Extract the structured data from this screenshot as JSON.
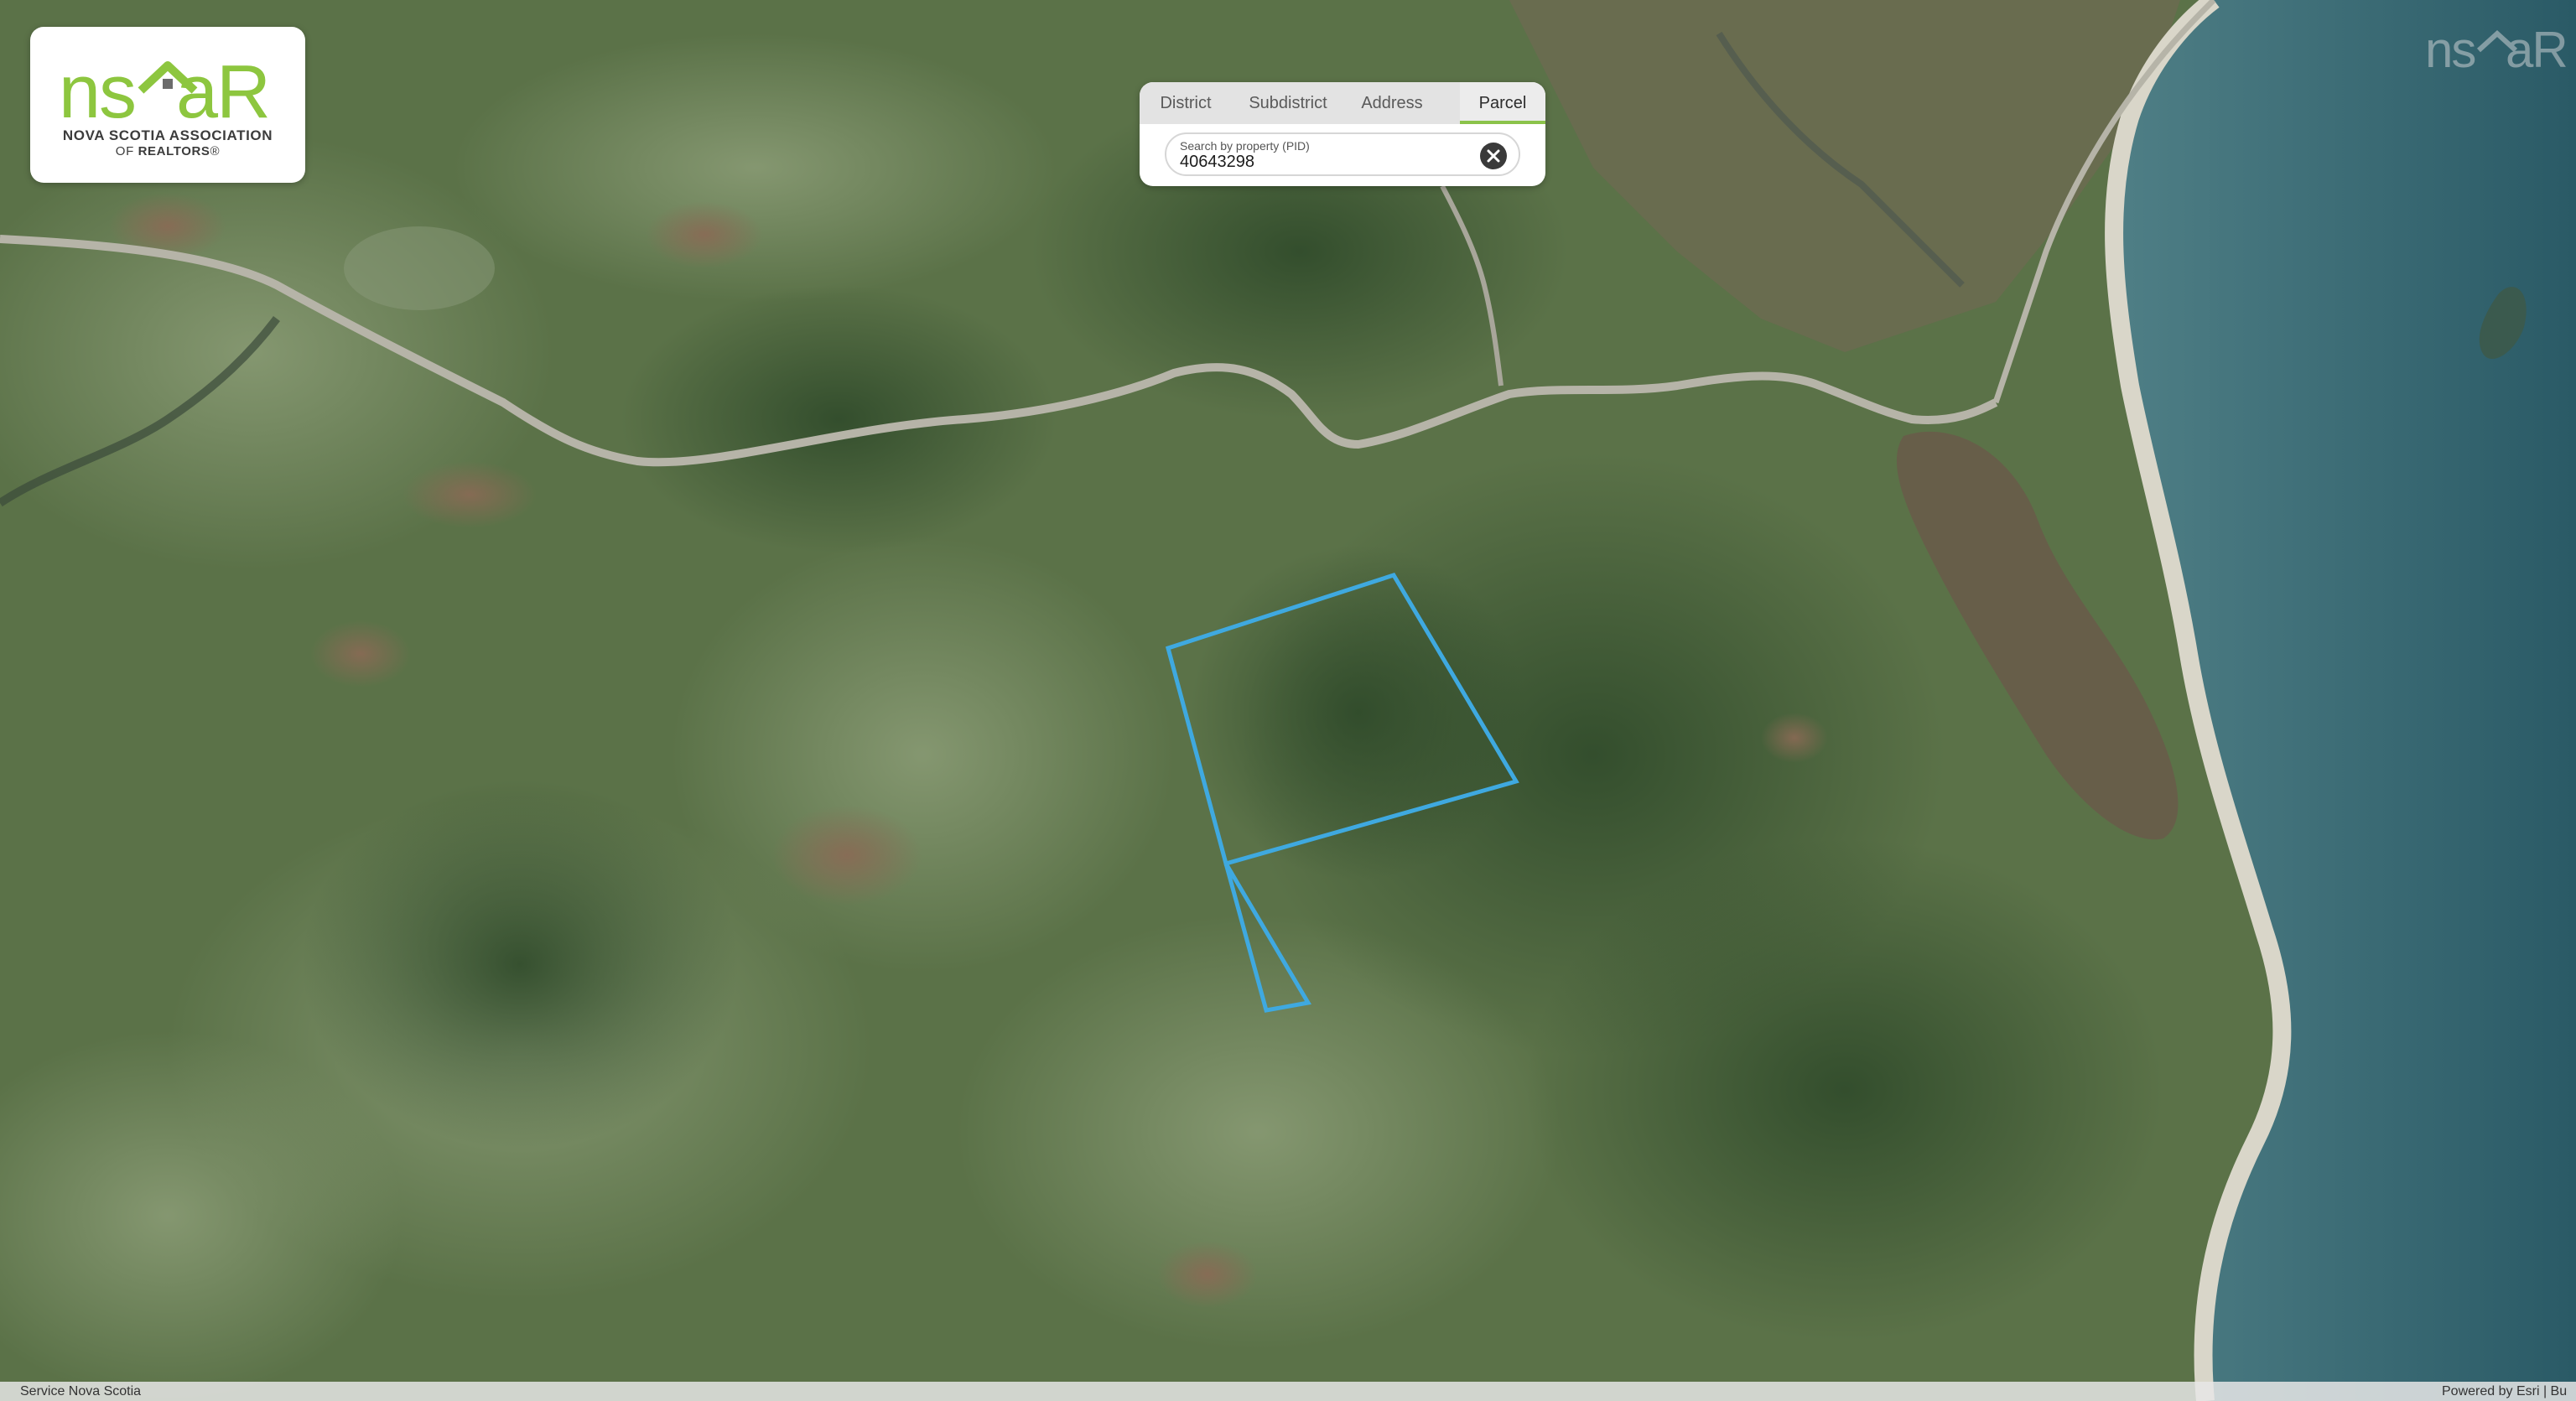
{
  "logo": {
    "wordmark": "nsaar",
    "line1": "NOVA SCOTIA ASSOCIATION",
    "line2_prefix": "OF ",
    "line2_bold": "REALTORS",
    "line2_suffix": "®"
  },
  "search": {
    "tabs": [
      {
        "label": "District"
      },
      {
        "label": "Subdistrict"
      },
      {
        "label": "Address"
      },
      {
        "label": "Parcel"
      }
    ],
    "active_tab": "Parcel",
    "field_label": "Search by property (PID)",
    "field_value": "40643298",
    "clear_icon": "close-circle-icon"
  },
  "map": {
    "basemap": "satellite-imagery",
    "parcel_outline_color": "#3fa9e0"
  },
  "attribution": {
    "left": "Service Nova Scotia",
    "right": "Powered by Esri | Bu"
  },
  "colors": {
    "accent": "#8bc34a",
    "logo_green": "#8dc63f",
    "parcel": "#3fa9e0"
  }
}
